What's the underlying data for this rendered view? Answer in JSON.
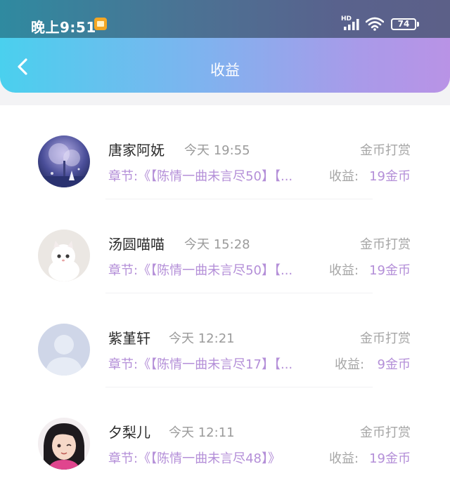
{
  "status_bar": {
    "time": "晚上9:51",
    "network_label": "HD",
    "battery": "74"
  },
  "header": {
    "title": "收益"
  },
  "records": [
    {
      "name": "唐家阿妩",
      "time": "今天 19:55",
      "type": "金币打赏",
      "chapter": "章节:《【陈情一曲未言尽50】【...",
      "earn_label": "收益:",
      "earn_value": "19金币"
    },
    {
      "name": "汤圆喵喵",
      "time": "今天 15:28",
      "type": "金币打赏",
      "chapter": "章节:《【陈情一曲未言尽50】【...",
      "earn_label": "收益:",
      "earn_value": "19金币"
    },
    {
      "name": "紫堇轩",
      "time": "今天 12:21",
      "type": "金币打赏",
      "chapter": "章节:《【陈情一曲未言尽17】【...",
      "earn_label": "收益:",
      "earn_value": "9金币"
    },
    {
      "name": "夕梨儿",
      "time": "今天 12:11",
      "type": "金币打赏",
      "chapter": "章节:《【陈情一曲未言尽48】》",
      "earn_label": "收益:",
      "earn_value": "19金币"
    }
  ]
}
